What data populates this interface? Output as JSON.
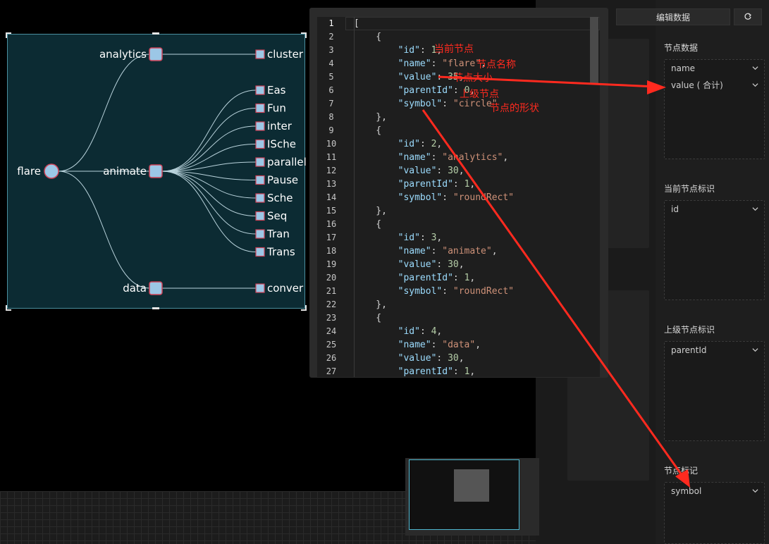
{
  "chart": {
    "nodes": {
      "root": "flare",
      "analytics": "analytics",
      "animate": "animate",
      "data": "data",
      "cluster": "cluster",
      "conver": "conver",
      "animate_children": [
        "Eas",
        "Fun",
        "inter",
        "ISche",
        "parallel",
        "Pause",
        "Sche",
        "Seq",
        "Tran",
        "Trans"
      ]
    },
    "colors": {
      "node_fill": "#9cc7e6",
      "node_stroke": "#d0455a",
      "link": "#b9d3dc",
      "bg": "#0c2b33"
    }
  },
  "editor": {
    "line_numbers": [
      "1",
      "2",
      "3",
      "4",
      "5",
      "6",
      "7",
      "8",
      "9",
      "10",
      "11",
      "12",
      "13",
      "14",
      "15",
      "16",
      "17",
      "18",
      "19",
      "20",
      "21",
      "22",
      "23",
      "24",
      "25",
      "26",
      "27"
    ],
    "code": [
      "[",
      "    {",
      "        \"id\": 1,",
      "        \"name\": \"flare\",",
      "        \"value\": 35,",
      "        \"parentId\": 0,",
      "        \"symbol\": \"circle\"",
      "    },",
      "    {",
      "        \"id\": 2,",
      "        \"name\": \"analytics\",",
      "        \"value\": 30,",
      "        \"parentId\": 1,",
      "        \"symbol\": \"roundRect\"",
      "    },",
      "    {",
      "        \"id\": 3,",
      "        \"name\": \"animate\",",
      "        \"value\": 30,",
      "        \"parentId\": 1,",
      "        \"symbol\": \"roundRect\"",
      "    },",
      "    {",
      "        \"id\": 4,",
      "        \"name\": \"data\",",
      "        \"value\": 30,",
      "        \"parentId\": 1,"
    ]
  },
  "annotations": {
    "current_node": "当前节点",
    "node_name": "节点名称",
    "node_size": "节点大小",
    "parent_node": "上级节点",
    "node_shape": "节点的形状"
  },
  "panel": {
    "edit_button": "编辑数据",
    "reset_icon": "refresh-icon",
    "sections": [
      {
        "title": "节点数据",
        "items": [
          "name",
          "value ( 合计)"
        ]
      },
      {
        "title": "当前节点标识",
        "items": [
          "id"
        ]
      },
      {
        "title": "上级节点标识",
        "items": [
          "parentId"
        ]
      },
      {
        "title": "节点标记",
        "items": [
          "symbol"
        ]
      }
    ]
  },
  "accent": "#ff2a1f"
}
